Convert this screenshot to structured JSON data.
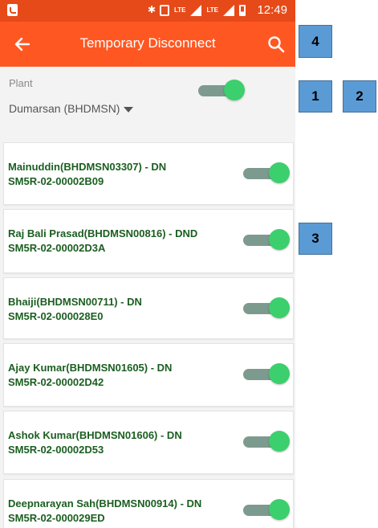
{
  "status_bar": {
    "time": "12:49",
    "lte_labels": [
      "LTE",
      "LTE"
    ],
    "icons": [
      "phone-app-icon",
      "bluetooth-icon",
      "vibrate-icon",
      "wifi-call-icon",
      "signal-icon",
      "signal-icon",
      "battery-icon"
    ]
  },
  "app_bar": {
    "title": "Temporary Disconnect",
    "back_icon": "arrow-back-icon",
    "search_icon": "search-icon",
    "color": "#ff5722"
  },
  "plant": {
    "label": "Plant",
    "selected": "Dumarsan (BHDMSN)",
    "toggle_on": true
  },
  "consumers": [
    {
      "name": "Mainuddin(BHDMSN03307) - DN",
      "meter": "SM5R-02-00002B09",
      "toggle_on": true
    },
    {
      "name": "Raj Bali Prasad(BHDMSN00816) - DND",
      "meter": "SM5R-02-00002D3A",
      "toggle_on": true
    },
    {
      "name": "Bhaiji(BHDMSN00711) - DN",
      "meter": "SM5R-02-000028E0",
      "toggle_on": true
    },
    {
      "name": "Ajay Kumar(BHDMSN01605) - DN",
      "meter": "SM5R-02-00002D42",
      "toggle_on": true
    },
    {
      "name": "Ashok Kumar(BHDMSN01606) - DN",
      "meter": "SM5R-02-00002D53",
      "toggle_on": true
    },
    {
      "name": "Deepnarayan Sah(BHDMSN00914) - DN",
      "meter": "SM5R-02-000029ED",
      "toggle_on": true
    }
  ],
  "callouts": [
    "4",
    "1",
    "2",
    "3"
  ],
  "colors": {
    "accent": "#ff5722",
    "status_bar": "#e64a19",
    "text_green": "#1b5e20",
    "toggle_thumb": "#3ccf6d",
    "callout": "#5b9bd5"
  }
}
